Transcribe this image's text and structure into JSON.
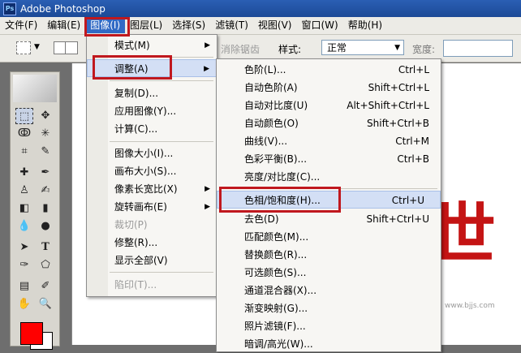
{
  "app": {
    "title": "Adobe Photoshop",
    "logo_text": "Ps"
  },
  "menubar": {
    "items": [
      {
        "label": "文件(F)"
      },
      {
        "label": "编辑(E)"
      },
      {
        "label": "图像(I)"
      },
      {
        "label": "图层(L)"
      },
      {
        "label": "选择(S)"
      },
      {
        "label": "滤镜(T)"
      },
      {
        "label": "视图(V)"
      },
      {
        "label": "窗口(W)"
      },
      {
        "label": "帮助(H)"
      }
    ],
    "active_index": 2
  },
  "options_bar": {
    "antialias_label": "消除锯齿",
    "style_label": "样式:",
    "style_value": "正常",
    "width_label": "宽度:"
  },
  "image_menu": {
    "items": [
      {
        "label": "模式(M)",
        "submenu": true
      },
      {
        "label": "调整(A)",
        "submenu": true,
        "highlighted": true
      },
      {
        "label": "复制(D)..."
      },
      {
        "label": "应用图像(Y)..."
      },
      {
        "label": "计算(C)..."
      },
      {
        "label": "图像大小(I)..."
      },
      {
        "label": "画布大小(S)..."
      },
      {
        "label": "像素长宽比(X)",
        "submenu": true
      },
      {
        "label": "旋转画布(E)",
        "submenu": true
      },
      {
        "label": "裁切(P)",
        "disabled": true
      },
      {
        "label": "修整(R)..."
      },
      {
        "label": "显示全部(V)"
      },
      {
        "label": "陷印(T)...",
        "disabled": true
      }
    ]
  },
  "adjust_menu": {
    "items": [
      {
        "label": "色阶(L)...",
        "shortcut": "Ctrl+L"
      },
      {
        "label": "自动色阶(A)",
        "shortcut": "Shift+Ctrl+L"
      },
      {
        "label": "自动对比度(U)",
        "shortcut": "Alt+Shift+Ctrl+L"
      },
      {
        "label": "自动颜色(O)",
        "shortcut": "Shift+Ctrl+B"
      },
      {
        "label": "曲线(V)...",
        "shortcut": "Ctrl+M"
      },
      {
        "label": "色彩平衡(B)...",
        "shortcut": "Ctrl+B"
      },
      {
        "label": "亮度/对比度(C)...",
        "shortcut": ""
      },
      {
        "label": "色相/饱和度(H)...",
        "shortcut": "Ctrl+U",
        "highlighted": true
      },
      {
        "label": "去色(D)",
        "shortcut": "Shift+Ctrl+U"
      },
      {
        "label": "匹配颜色(M)...",
        "shortcut": ""
      },
      {
        "label": "替换颜色(R)...",
        "shortcut": ""
      },
      {
        "label": "可选颜色(S)...",
        "shortcut": ""
      },
      {
        "label": "通道混合器(X)...",
        "shortcut": ""
      },
      {
        "label": "渐变映射(G)...",
        "shortcut": ""
      },
      {
        "label": "照片滤镜(F)...",
        "shortcut": ""
      },
      {
        "label": "暗调/高光(W)...",
        "shortcut": ""
      }
    ]
  },
  "canvas": {
    "text": "世",
    "watermark": "www.bjjs.com"
  },
  "colors": {
    "foreground": "#ff0000",
    "background": "#ffffff",
    "highlight_box": "#c0181e",
    "menu_hover": "#d3dff5"
  }
}
